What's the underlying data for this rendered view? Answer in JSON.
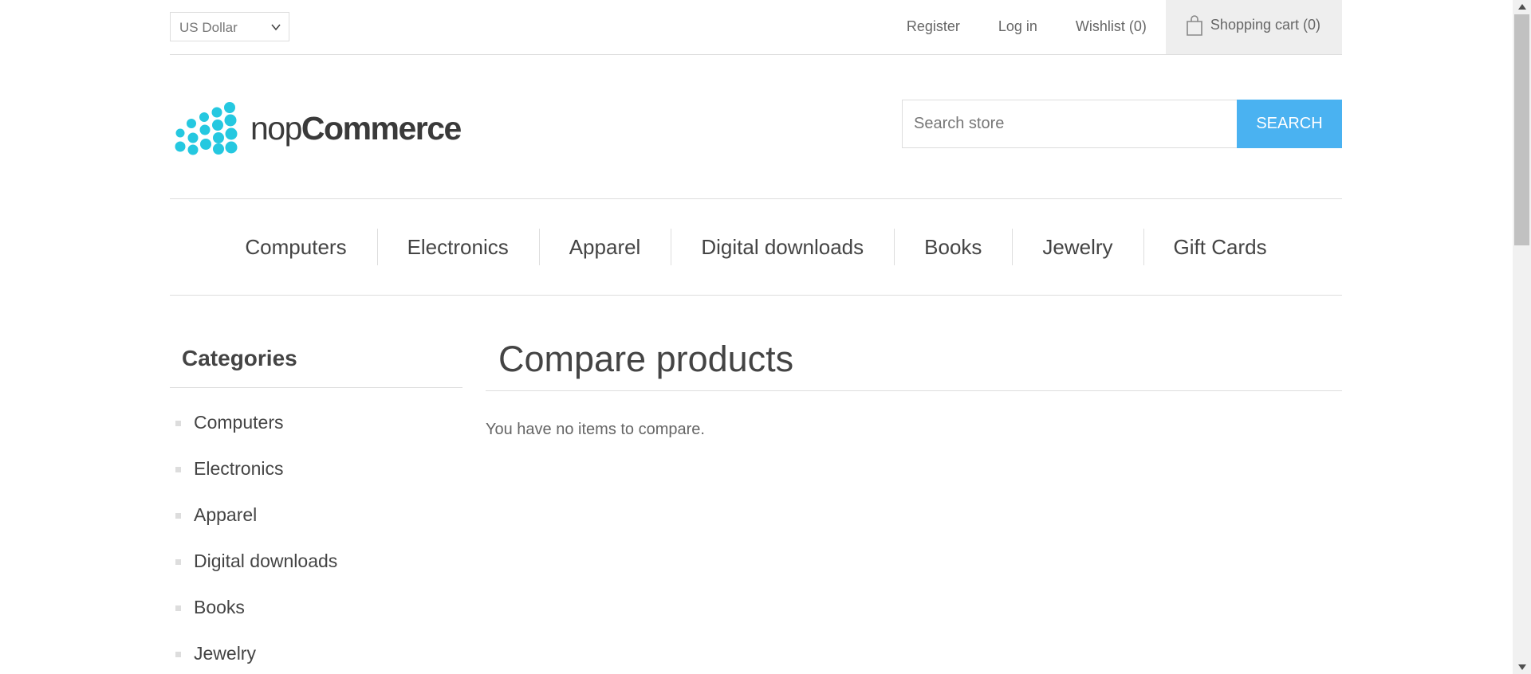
{
  "header": {
    "currency": "US Dollar",
    "links": {
      "register": "Register",
      "login": "Log in",
      "wishlist": "Wishlist (0)",
      "cart": "Shopping cart (0)"
    }
  },
  "logo": {
    "text_light": "nop",
    "text_bold": "Commerce"
  },
  "search": {
    "placeholder": "Search store",
    "button": "SEARCH"
  },
  "top_menu": [
    "Computers",
    "Electronics",
    "Apparel",
    "Digital downloads",
    "Books",
    "Jewelry",
    "Gift Cards"
  ],
  "sidebar": {
    "title": "Categories",
    "items": [
      "Computers",
      "Electronics",
      "Apparel",
      "Digital downloads",
      "Books",
      "Jewelry"
    ]
  },
  "main": {
    "title": "Compare products",
    "message": "You have no items to compare."
  },
  "colors": {
    "accent": "#4ab2f1",
    "logo": "#25c8e0",
    "border": "#dddddd"
  }
}
